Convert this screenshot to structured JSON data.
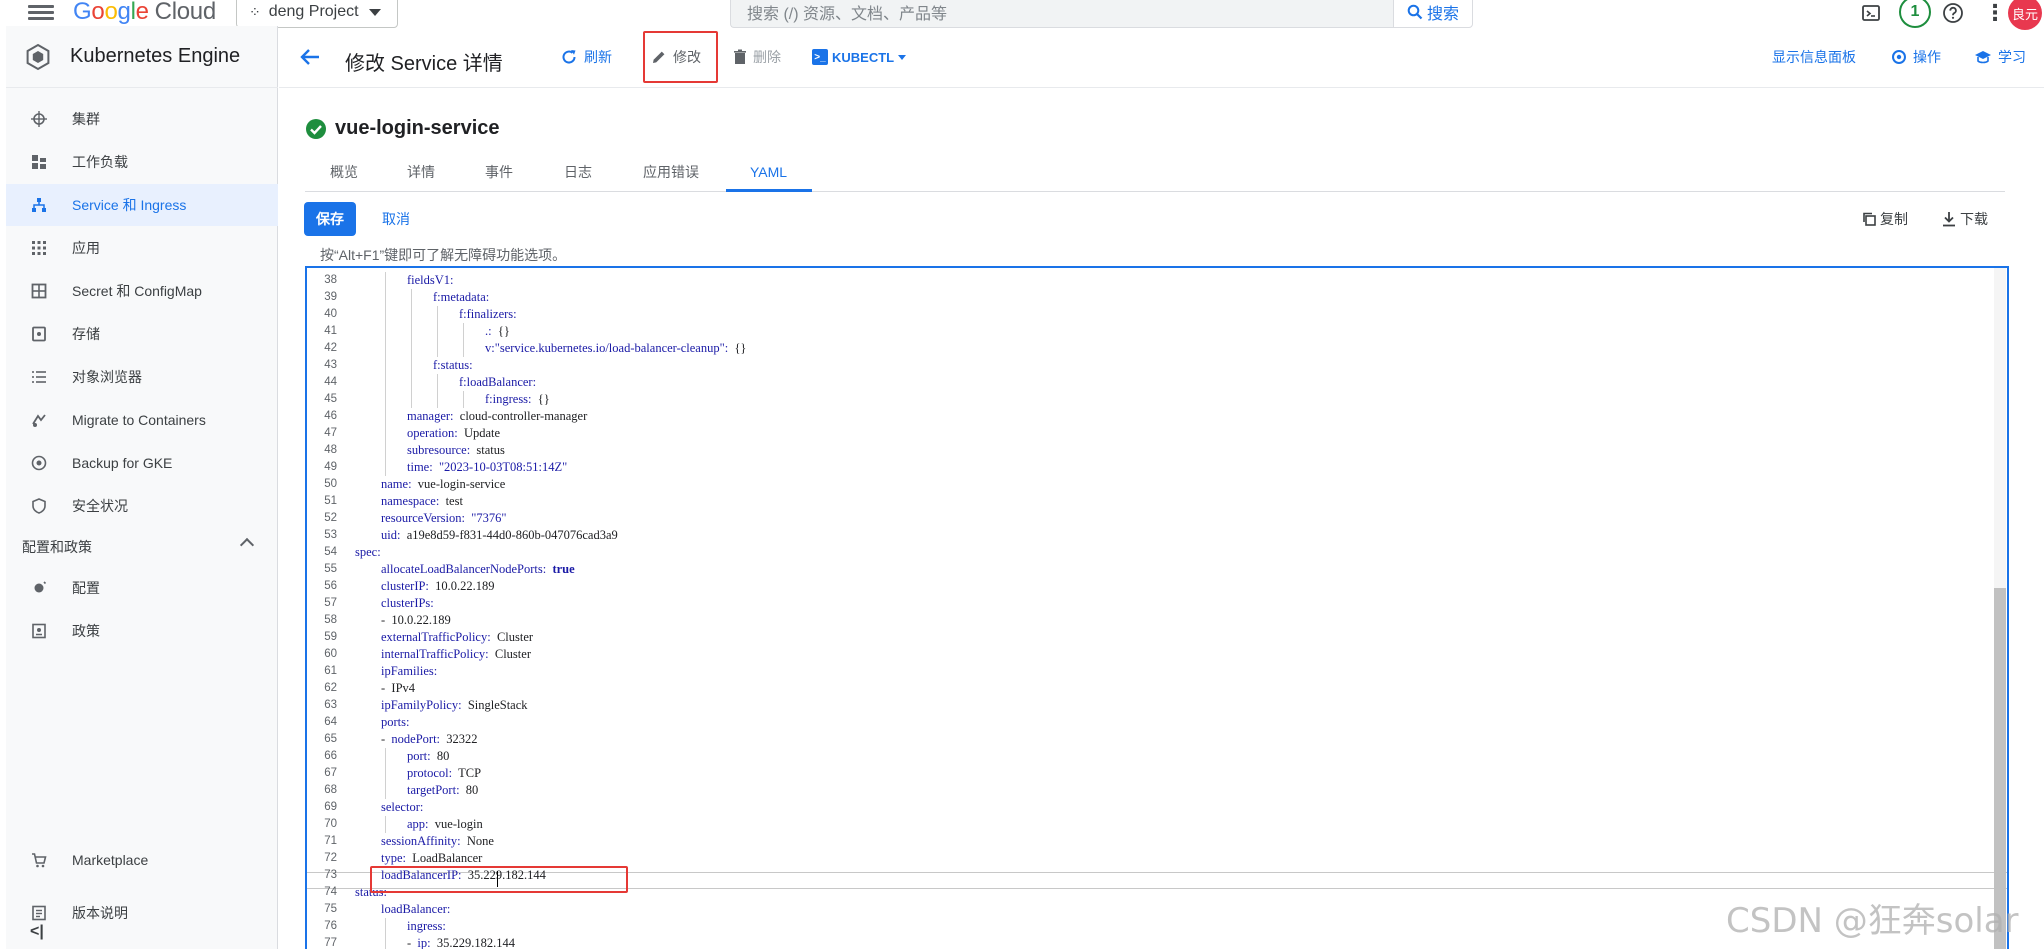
{
  "topbar": {
    "logo_google": [
      "G",
      "o",
      "o",
      "g",
      "l",
      "e"
    ],
    "logo_cloud": "Cloud",
    "project_name": "deng Project",
    "search_placeholder": "搜索 (/) 资源、文档、产品等",
    "search_button": "搜索",
    "notification_count": "1",
    "avatar_text": "良元"
  },
  "sidebar": {
    "product_title": "Kubernetes Engine",
    "items": [
      {
        "label": "集群",
        "icon": "cluster-icon"
      },
      {
        "label": "工作负载",
        "icon": "workloads-icon"
      },
      {
        "label": "Service 和 Ingress",
        "icon": "network-icon",
        "active": true
      },
      {
        "label": "应用",
        "icon": "apps-icon"
      },
      {
        "label": "Secret 和 ConfigMap",
        "icon": "grid-icon"
      },
      {
        "label": "存储",
        "icon": "storage-icon"
      },
      {
        "label": "对象浏览器",
        "icon": "list-icon"
      },
      {
        "label": "Migrate to Containers",
        "icon": "migrate-icon"
      },
      {
        "label": "Backup for GKE",
        "icon": "backup-icon"
      },
      {
        "label": "安全状况",
        "icon": "shield-icon"
      }
    ],
    "section_title": "配置和政策",
    "section_items": [
      {
        "label": "配置",
        "icon": "config-icon"
      },
      {
        "label": "政策",
        "icon": "policy-icon"
      }
    ],
    "bottom_items": [
      {
        "label": "Marketplace",
        "icon": "cart-icon"
      },
      {
        "label": "版本说明",
        "icon": "notes-icon"
      }
    ],
    "collapse_label": "<|"
  },
  "header": {
    "title": "修改 Service 详情",
    "refresh": "刷新",
    "edit": "修改",
    "delete": "删除",
    "kubectl": "KUBECTL",
    "show_panel": "显示信息面板",
    "actions": "操作",
    "learn": "学习"
  },
  "service": {
    "name": "vue-login-service",
    "status_color": "#1e8e3e"
  },
  "tabs": [
    {
      "label": "概览"
    },
    {
      "label": "详情"
    },
    {
      "label": "事件"
    },
    {
      "label": "日志"
    },
    {
      "label": "应用错误"
    },
    {
      "label": "YAML",
      "active": true
    }
  ],
  "editor_toolbar": {
    "save": "保存",
    "cancel": "取消",
    "copy": "复制",
    "download": "下载",
    "hint": "按“Alt+F1”键即可了解无障碍功能选项。"
  },
  "yaml_lines": [
    {
      "n": "38",
      "indent": 2,
      "parts": [
        [
          "k",
          "fieldsV1:"
        ]
      ]
    },
    {
      "n": "39",
      "indent": 3,
      "parts": [
        [
          "k",
          "f:metadata:"
        ]
      ]
    },
    {
      "n": "40",
      "indent": 4,
      "parts": [
        [
          "k",
          "f:finalizers:"
        ]
      ]
    },
    {
      "n": "41",
      "indent": 5,
      "parts": [
        [
          "k",
          ".:"
        ],
        [
          "p",
          "  {}"
        ]
      ]
    },
    {
      "n": "42",
      "indent": 5,
      "parts": [
        [
          "k",
          "v:\"service.kubernetes.io/load-balancer-cleanup\":"
        ],
        [
          "p",
          "  {}"
        ]
      ]
    },
    {
      "n": "43",
      "indent": 3,
      "parts": [
        [
          "k",
          "f:status:"
        ]
      ]
    },
    {
      "n": "44",
      "indent": 4,
      "parts": [
        [
          "k",
          "f:loadBalancer:"
        ]
      ]
    },
    {
      "n": "45",
      "indent": 5,
      "parts": [
        [
          "k",
          "f:ingress:"
        ],
        [
          "p",
          "  {}"
        ]
      ]
    },
    {
      "n": "46",
      "indent": 2,
      "parts": [
        [
          "k",
          "manager:"
        ],
        [
          "v",
          "  cloud-controller-manager"
        ]
      ]
    },
    {
      "n": "47",
      "indent": 2,
      "parts": [
        [
          "k",
          "operation:"
        ],
        [
          "v",
          "  Update"
        ]
      ]
    },
    {
      "n": "48",
      "indent": 2,
      "parts": [
        [
          "k",
          "subresource:"
        ],
        [
          "v",
          "  status"
        ]
      ]
    },
    {
      "n": "49",
      "indent": 2,
      "parts": [
        [
          "k",
          "time:"
        ],
        [
          "s",
          "  \"2023-10-03T08:51:14Z\""
        ]
      ]
    },
    {
      "n": "50",
      "indent": 1,
      "parts": [
        [
          "k",
          "name:"
        ],
        [
          "v",
          "  vue-login-service"
        ]
      ]
    },
    {
      "n": "51",
      "indent": 1,
      "parts": [
        [
          "k",
          "namespace:"
        ],
        [
          "v",
          "  test"
        ]
      ]
    },
    {
      "n": "52",
      "indent": 1,
      "parts": [
        [
          "k",
          "resourceVersion:"
        ],
        [
          "s",
          "  \"7376\""
        ]
      ]
    },
    {
      "n": "53",
      "indent": 1,
      "parts": [
        [
          "k",
          "uid:"
        ],
        [
          "v",
          "  a19e8d59-f831-44d0-860b-047076cad3a9"
        ]
      ]
    },
    {
      "n": "54",
      "indent": 0,
      "parts": [
        [
          "k",
          "spec:"
        ]
      ]
    },
    {
      "n": "55",
      "indent": 1,
      "parts": [
        [
          "k",
          "allocateLoadBalancerNodePorts:"
        ],
        [
          "b",
          "  true"
        ]
      ]
    },
    {
      "n": "56",
      "indent": 1,
      "parts": [
        [
          "k",
          "clusterIP:"
        ],
        [
          "v",
          "  10.0.22.189"
        ]
      ]
    },
    {
      "n": "57",
      "indent": 1,
      "parts": [
        [
          "k",
          "clusterIPs:"
        ]
      ]
    },
    {
      "n": "58",
      "indent": 1,
      "parts": [
        [
          "p",
          "-  "
        ],
        [
          "v",
          "10.0.22.189"
        ]
      ]
    },
    {
      "n": "59",
      "indent": 1,
      "parts": [
        [
          "k",
          "externalTrafficPolicy:"
        ],
        [
          "v",
          "  Cluster"
        ]
      ]
    },
    {
      "n": "60",
      "indent": 1,
      "parts": [
        [
          "k",
          "internalTrafficPolicy:"
        ],
        [
          "v",
          "  Cluster"
        ]
      ]
    },
    {
      "n": "61",
      "indent": 1,
      "parts": [
        [
          "k",
          "ipFamilies:"
        ]
      ]
    },
    {
      "n": "62",
      "indent": 1,
      "parts": [
        [
          "p",
          "-  "
        ],
        [
          "v",
          "IPv4"
        ]
      ]
    },
    {
      "n": "63",
      "indent": 1,
      "parts": [
        [
          "k",
          "ipFamilyPolicy:"
        ],
        [
          "v",
          "  SingleStack"
        ]
      ]
    },
    {
      "n": "64",
      "indent": 1,
      "parts": [
        [
          "k",
          "ports:"
        ]
      ]
    },
    {
      "n": "65",
      "indent": 1,
      "parts": [
        [
          "p",
          "-  "
        ],
        [
          "k",
          "nodePort:"
        ],
        [
          "v",
          "  32322"
        ]
      ]
    },
    {
      "n": "66",
      "indent": 2,
      "parts": [
        [
          "k",
          "port:"
        ],
        [
          "v",
          "  80"
        ]
      ]
    },
    {
      "n": "67",
      "indent": 2,
      "parts": [
        [
          "k",
          "protocol:"
        ],
        [
          "v",
          "  TCP"
        ]
      ]
    },
    {
      "n": "68",
      "indent": 2,
      "parts": [
        [
          "k",
          "targetPort:"
        ],
        [
          "v",
          "  80"
        ]
      ]
    },
    {
      "n": "69",
      "indent": 1,
      "parts": [
        [
          "k",
          "selector:"
        ]
      ]
    },
    {
      "n": "70",
      "indent": 2,
      "parts": [
        [
          "k",
          "app:"
        ],
        [
          "v",
          "  vue-login"
        ]
      ]
    },
    {
      "n": "71",
      "indent": 1,
      "parts": [
        [
          "k",
          "sessionAffinity:"
        ],
        [
          "v",
          "  None"
        ]
      ]
    },
    {
      "n": "72",
      "indent": 1,
      "parts": [
        [
          "k",
          "type:"
        ],
        [
          "v",
          "  LoadBalancer"
        ]
      ]
    },
    {
      "n": "73",
      "indent": 1,
      "parts": [
        [
          "k",
          "loadBalancerIP:"
        ],
        [
          "v",
          "  35.229.182.144"
        ]
      ]
    },
    {
      "n": "74",
      "indent": 0,
      "parts": [
        [
          "k",
          "status:"
        ]
      ]
    },
    {
      "n": "75",
      "indent": 1,
      "parts": [
        [
          "k",
          "loadBalancer:"
        ]
      ]
    },
    {
      "n": "76",
      "indent": 2,
      "parts": [
        [
          "k",
          "ingress:"
        ]
      ]
    },
    {
      "n": "77",
      "indent": 2,
      "parts": [
        [
          "p",
          "-  "
        ],
        [
          "k",
          "ip:"
        ],
        [
          "v",
          "  35.229.182.144"
        ]
      ]
    }
  ],
  "watermark": "CSDN @狂奔solar",
  "colors": {
    "accent": "#1a73e8",
    "highlight_red": "#e53935",
    "sidebar_bg": "#f8f9fa"
  }
}
